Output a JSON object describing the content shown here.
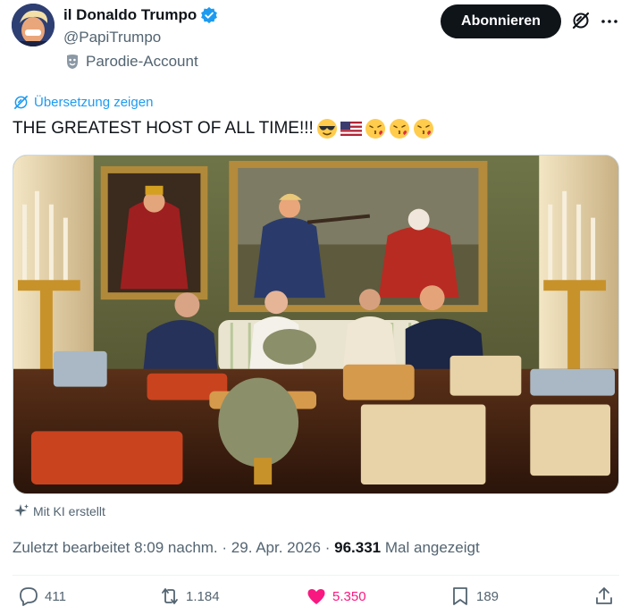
{
  "author": {
    "display_name": "il Donaldo Trumpo",
    "handle": "@PapiTrumpo",
    "parody_label": "Parodie-Account"
  },
  "header": {
    "subscribe_label": "Abonnieren"
  },
  "post": {
    "translate_label": "Übersetzung zeigen",
    "text": "THE GREATEST HOST OF ALL TIME!!!",
    "emojis": [
      "smiling-face-with-sunglasses",
      "flag-us",
      "face-blowing-a-kiss",
      "face-blowing-a-kiss",
      "face-blowing-a-kiss"
    ],
    "ai_label": "Mit KI erstellt",
    "edited_prefix": "Zuletzt bearbeitet",
    "time": "8:09 nachm.",
    "date": "29. Apr. 2026",
    "separator": "·",
    "views_count": "96.331",
    "views_label": "Mal angezeigt"
  },
  "actions": {
    "replies": "411",
    "reposts": "1.184",
    "likes": "5.350",
    "bookmarks": "189",
    "like_color": "#f91880"
  },
  "colors": {
    "accent": "#1d9bf0",
    "text": "#0f1419",
    "secondary": "#536471"
  }
}
